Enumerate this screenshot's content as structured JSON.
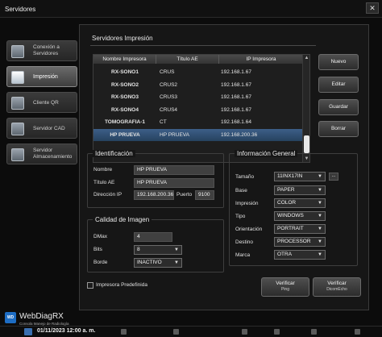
{
  "window": {
    "title": "Servidores",
    "close_label": "✕"
  },
  "nav": {
    "items": [
      {
        "label": "Conexión a Servidores",
        "icon": "server-connection-icon",
        "active": false
      },
      {
        "label": "Impresión",
        "icon": "printer-icon",
        "active": true
      },
      {
        "label": "Cliente QR",
        "icon": "qr-client-icon",
        "active": false
      },
      {
        "label": "Servidor CAD",
        "icon": "cad-server-icon",
        "active": false
      },
      {
        "label": "Servidor Almacenamiento",
        "icon": "storage-server-icon",
        "active": false
      }
    ]
  },
  "panel": {
    "title": "Servidores Impresión",
    "table": {
      "headers": [
        "Nombre Impresora",
        "Título AE",
        "IP Impresora"
      ],
      "rows": [
        [
          "RX-SONO1",
          "CRUS",
          "192.168.1.67"
        ],
        [
          "RX-SONO2",
          "CRUS2",
          "192.168.1.67"
        ],
        [
          "RX-SONO3",
          "CRUS3",
          "192.168.1.67"
        ],
        [
          "RX-SONO4",
          "CRUS4",
          "192.168.1.67"
        ],
        [
          "TOMOGRAFIA-1",
          "CT",
          "192.168.1.64"
        ],
        [
          "HP PRUEVA",
          "HP PRUEVA",
          "192.168.200.36"
        ]
      ],
      "selected_row": 5
    },
    "buttons": {
      "nuevo": "Nuevo",
      "editar": "Editar",
      "guardar": "Guardar",
      "borrar": "Borrar"
    }
  },
  "identificacion": {
    "title": "Identificación",
    "nombre_label": "Nombre",
    "nombre_value": "HP PRUEVA",
    "titulo_label": "Título AE",
    "titulo_value": "HP PRUEVA",
    "ip_label": "Dirección IP",
    "ip_value": "192.168.200.36",
    "puerto_label": "Puerto",
    "puerto_value": "9100"
  },
  "calidad": {
    "title": "Calidad de Imagen",
    "dmax_label": "DMax",
    "dmax_value": "4",
    "bits_label": "Bits",
    "bits_value": "8",
    "borde_label": "Borde",
    "borde_value": "INACTIVO"
  },
  "info": {
    "title": "Información General",
    "tamano_label": "Tamaño",
    "tamano_value": "11INX17IN",
    "more_label": "...",
    "base_label": "Base",
    "base_value": "PAPER",
    "impresion_label": "Impresión",
    "impresion_value": "COLOR",
    "tipo_label": "Tipo",
    "tipo_value": "WINDOWS",
    "orientacion_label": "Orientación",
    "orientacion_value": "PORTRAIT",
    "destino_label": "Destino",
    "destino_value": "PROCESSOR",
    "marca_label": "Marca",
    "marca_value": "OTRA"
  },
  "footer": {
    "predefinida_label": "Impresora Predefinida",
    "verificar_ping": {
      "title": "Verificar",
      "sub": "Ping"
    },
    "verificar_dicom": {
      "title": "Verificar",
      "sub": "DicomEcho"
    }
  },
  "logo": {
    "mark": "WD",
    "name": "WebDiagRX",
    "sub": "Consola Manejo de Radiología"
  },
  "taskbar": {
    "date": "01/11/2023 12:00 a. m."
  },
  "colors": {
    "selection": "#3d5f88",
    "accent": "#1d6dc4"
  }
}
